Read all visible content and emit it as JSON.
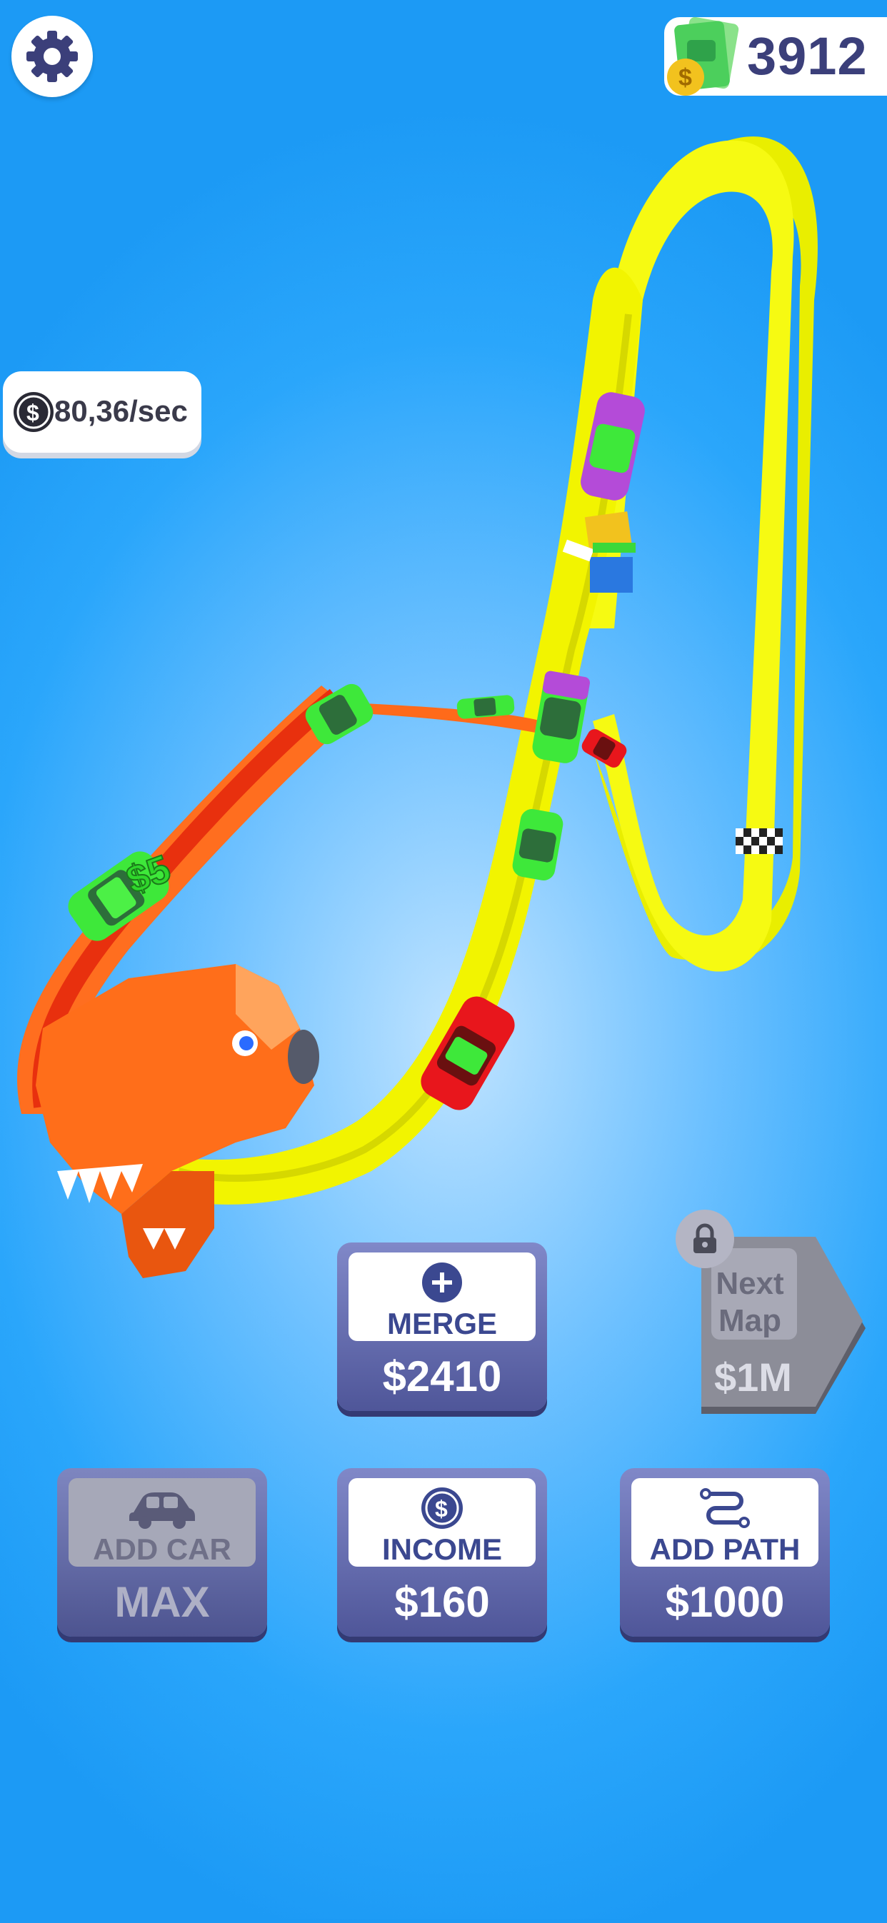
{
  "hud": {
    "settings_icon": "gear-icon",
    "money": "3912",
    "money_icon": "cash-stack-icon",
    "rate": "80,36/sec",
    "rate_icon": "coin-icon"
  },
  "track": {
    "price_popup": "$5",
    "finish_icon": "checkered-flag-icon"
  },
  "buttons": {
    "merge": {
      "label": "MERGE",
      "price": "$2410",
      "icon": "plus-icon"
    },
    "add_car": {
      "label": "ADD CAR",
      "price": "MAX",
      "icon": "car-icon"
    },
    "income": {
      "label": "INCOME",
      "price": "$160",
      "icon": "coin-icon"
    },
    "add_path": {
      "label": "ADD PATH",
      "price": "$1000",
      "icon": "path-icon"
    },
    "next_map": {
      "label_line1": "Next",
      "label_line2": "Map",
      "price": "$1M",
      "icon": "lock-icon"
    }
  },
  "colors": {
    "track_yellow": "#f4f800",
    "track_orange": "#ff6a1a",
    "button_blue": "#5a62a8",
    "car_green": "#3ee83a",
    "car_red": "#e8161c",
    "car_purple": "#b44bd8"
  }
}
